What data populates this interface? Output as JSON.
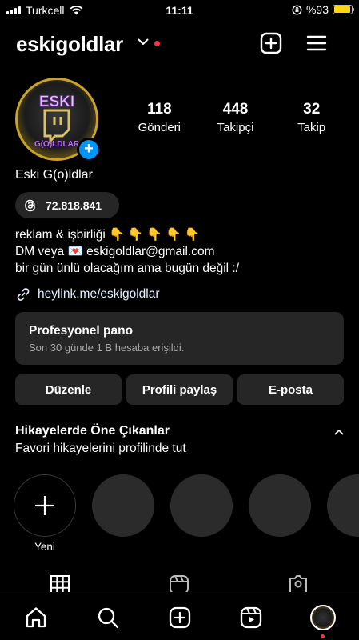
{
  "status_bar": {
    "carrier": "Turkcell",
    "time": "11:11",
    "battery": "%93",
    "battery_level": 0.93
  },
  "header": {
    "username": "eskigoldlar"
  },
  "profile": {
    "avatar_text_top": "ESKI",
    "avatar_text_bottom": "G(O)LDLAR",
    "stats": [
      {
        "value": "118",
        "label": "Gönderi"
      },
      {
        "value": "448",
        "label": "Takipçi"
      },
      {
        "value": "32",
        "label": "Takip"
      }
    ],
    "display_name": "Eski G(o)ldlar",
    "threads_count": "72.818.841",
    "bio_lines": [
      "reklam & işbirliği 👇 👇 👇 👇 👇",
      "DM veya 💌 eskigoldlar@gmail.com",
      "bir gün ünlü olacağım ama bugün değil :/"
    ],
    "link": "heylink.me/eskigoldlar"
  },
  "dashboard": {
    "title": "Profesyonel pano",
    "subtitle": "Son 30 günde 1 B hesaba erişildi."
  },
  "buttons": {
    "edit": "Düzenle",
    "share": "Profili paylaş",
    "email": "E-posta"
  },
  "highlights": {
    "title": "Hikayelerde Öne Çıkanlar",
    "subtitle": "Favori hikayelerini profilinde tut",
    "new_label": "Yeni"
  },
  "colors": {
    "accent_blue": "#0095f6",
    "notification_red": "#ff3040",
    "gold": "#c9a227",
    "battery_yellow": "#ffd60a",
    "surface": "#262626"
  }
}
